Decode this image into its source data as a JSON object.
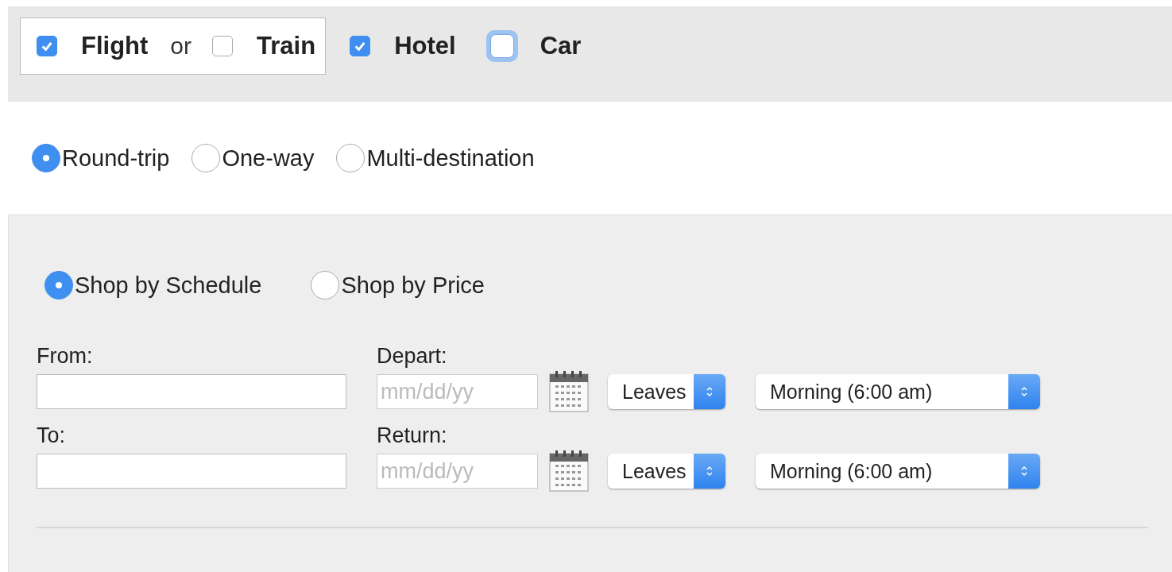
{
  "transport_group": {
    "options": [
      {
        "label": "Flight",
        "checked": true,
        "focused": false
      },
      {
        "label": "Train",
        "checked": false,
        "focused": false
      }
    ],
    "separator": "or"
  },
  "extras": [
    {
      "label": "Hotel",
      "checked": true,
      "focused": false
    },
    {
      "label": "Car",
      "checked": false,
      "focused": true
    }
  ],
  "trip_types": [
    {
      "label": "Round-trip",
      "selected": true
    },
    {
      "label": "One-way",
      "selected": false
    },
    {
      "label": "Multi-destination",
      "selected": false
    }
  ],
  "shop_modes": [
    {
      "label": "Shop by Schedule",
      "selected": true
    },
    {
      "label": "Shop by Price",
      "selected": false
    }
  ],
  "rows": [
    {
      "location_label": "From:",
      "date_label": "Depart:",
      "date_placeholder": "mm/dd/yy",
      "time_mode": "Leaves",
      "time": "Morning (6:00 am)"
    },
    {
      "location_label": "To:",
      "date_label": "Return:",
      "date_placeholder": "mm/dd/yy",
      "time_mode": "Leaves",
      "time": "Morning (6:00 am)"
    }
  ]
}
